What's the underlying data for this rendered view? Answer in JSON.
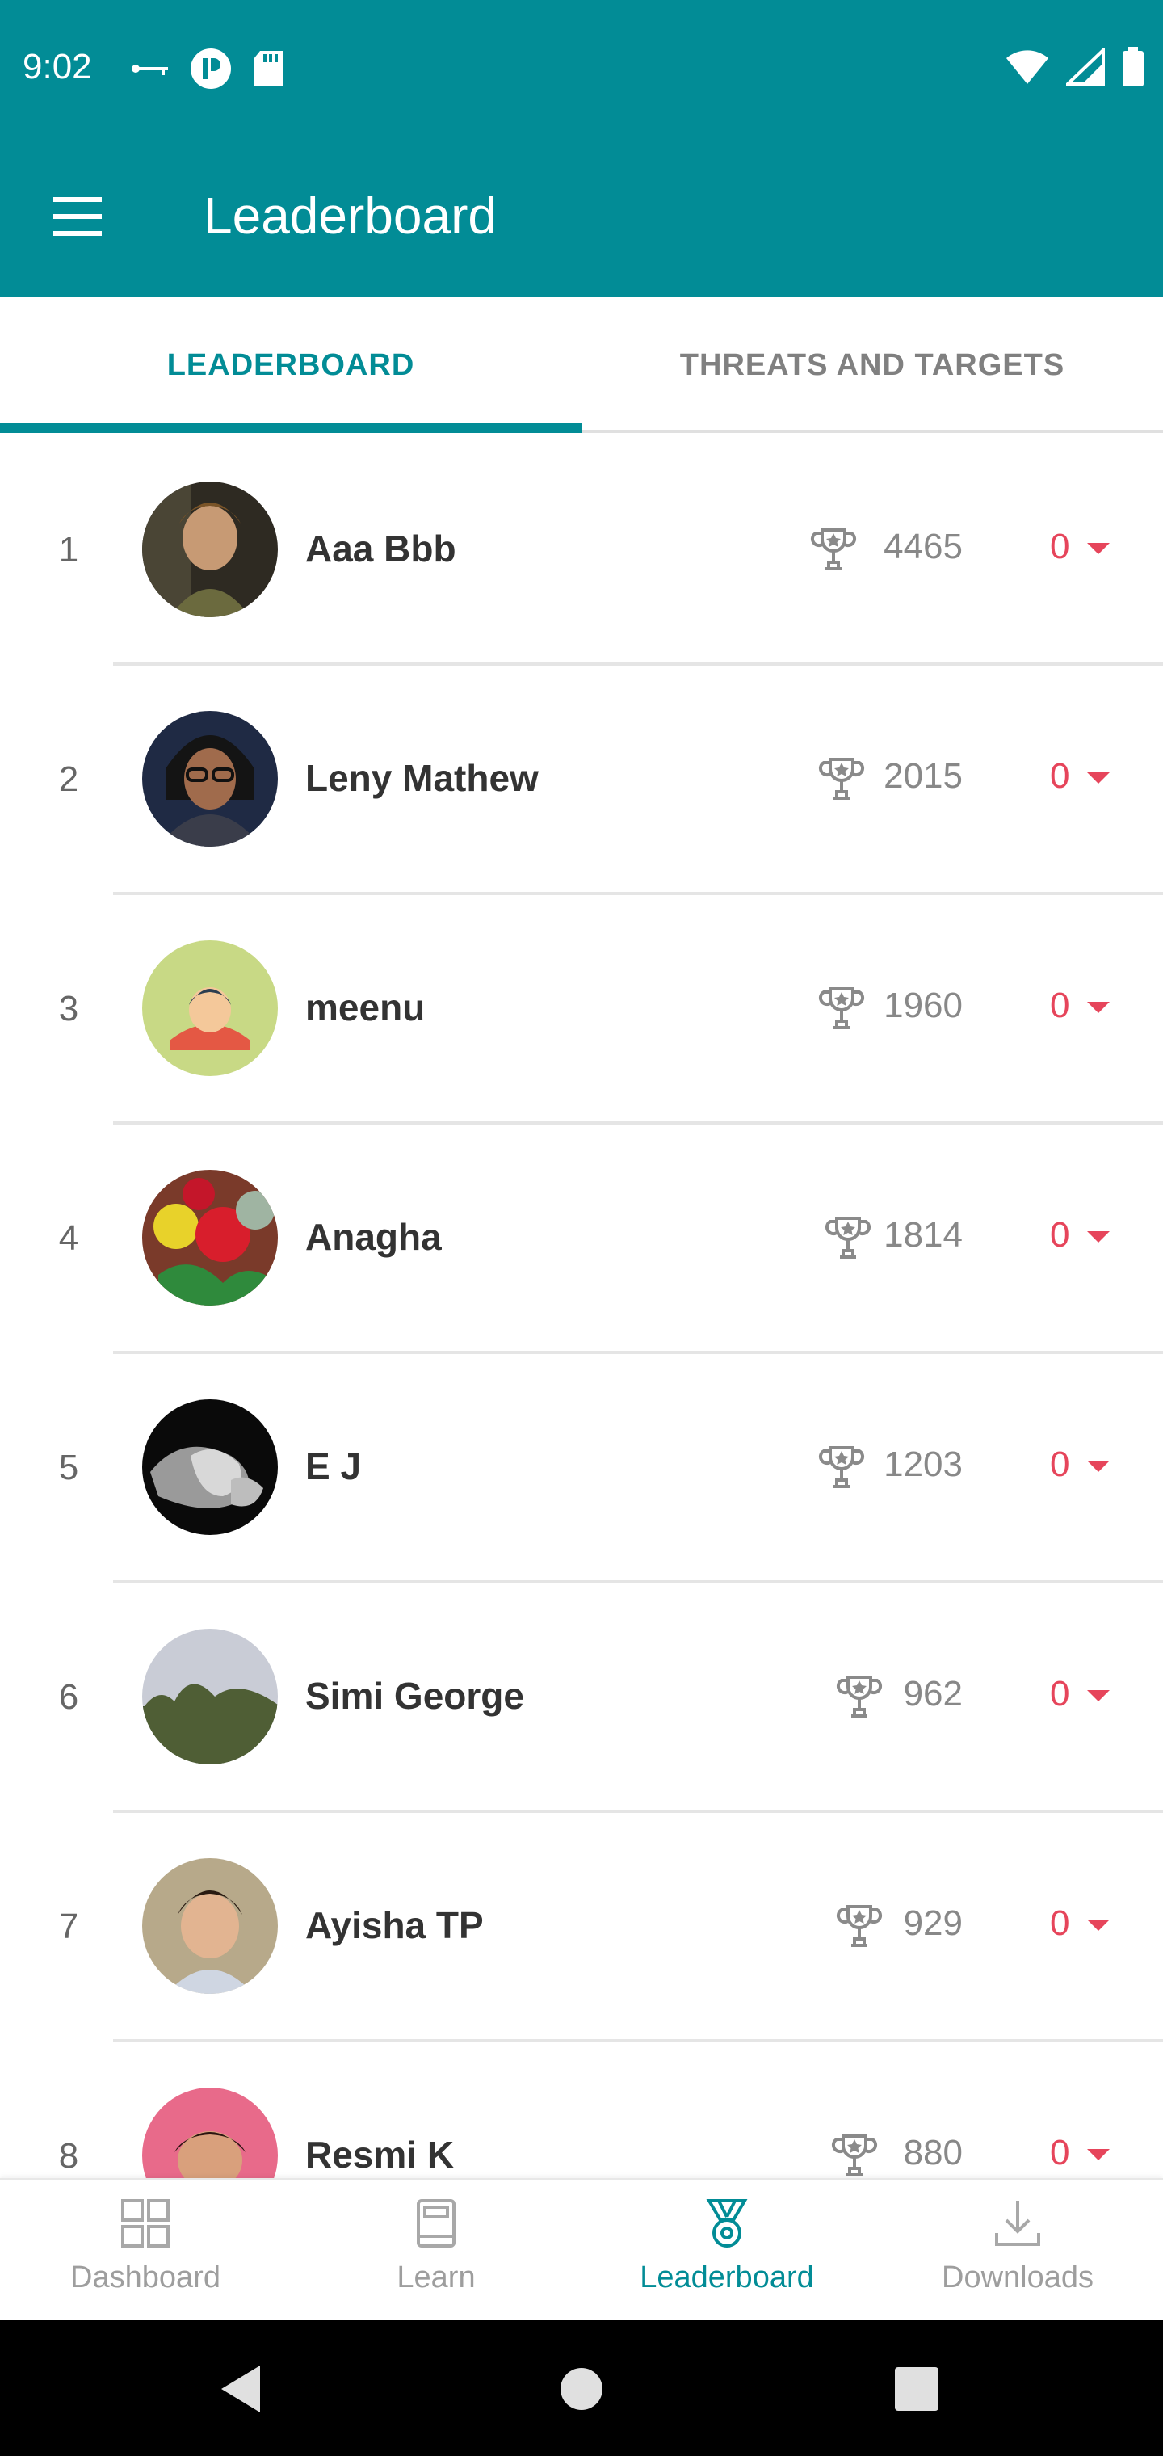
{
  "status_bar": {
    "time": "9:02",
    "icons_left": [
      "key-icon",
      "badge-p-icon",
      "sd-card-icon"
    ],
    "icons_right": [
      "wifi-icon",
      "signal-icon",
      "battery-icon"
    ]
  },
  "app_bar": {
    "title": "Leaderboard",
    "menu_icon": "hamburger-menu-icon"
  },
  "tabs": [
    {
      "label": "LEADERBOARD",
      "active": true
    },
    {
      "label": "THREATS AND TARGETS",
      "active": false
    }
  ],
  "leaderboard": [
    {
      "rank": "1",
      "name": "Aaa Bbb",
      "score": "4465",
      "change": "0"
    },
    {
      "rank": "2",
      "name": "Leny Mathew",
      "score": "2015",
      "change": "0"
    },
    {
      "rank": "3",
      "name": "meenu",
      "score": "1960",
      "change": "0"
    },
    {
      "rank": "4",
      "name": "Anagha",
      "score": "1814",
      "change": "0"
    },
    {
      "rank": "5",
      "name": "E J",
      "score": "1203",
      "change": "0"
    },
    {
      "rank": "6",
      "name": "Simi George",
      "score": "962",
      "change": "0"
    },
    {
      "rank": "7",
      "name": "Ayisha TP",
      "score": "929",
      "change": "0"
    },
    {
      "rank": "8",
      "name": "Resmi  K",
      "score": "880",
      "change": "0"
    }
  ],
  "bottom_nav": [
    {
      "label": "Dashboard",
      "icon": "dashboard-icon",
      "active": false
    },
    {
      "label": "Learn",
      "icon": "book-icon",
      "active": false
    },
    {
      "label": "Leaderboard",
      "icon": "medal-icon",
      "active": true
    },
    {
      "label": "Downloads",
      "icon": "download-icon",
      "active": false
    }
  ],
  "colors": {
    "primary": "#028c96",
    "rank_change": "#e6455b",
    "muted": "#808080"
  }
}
